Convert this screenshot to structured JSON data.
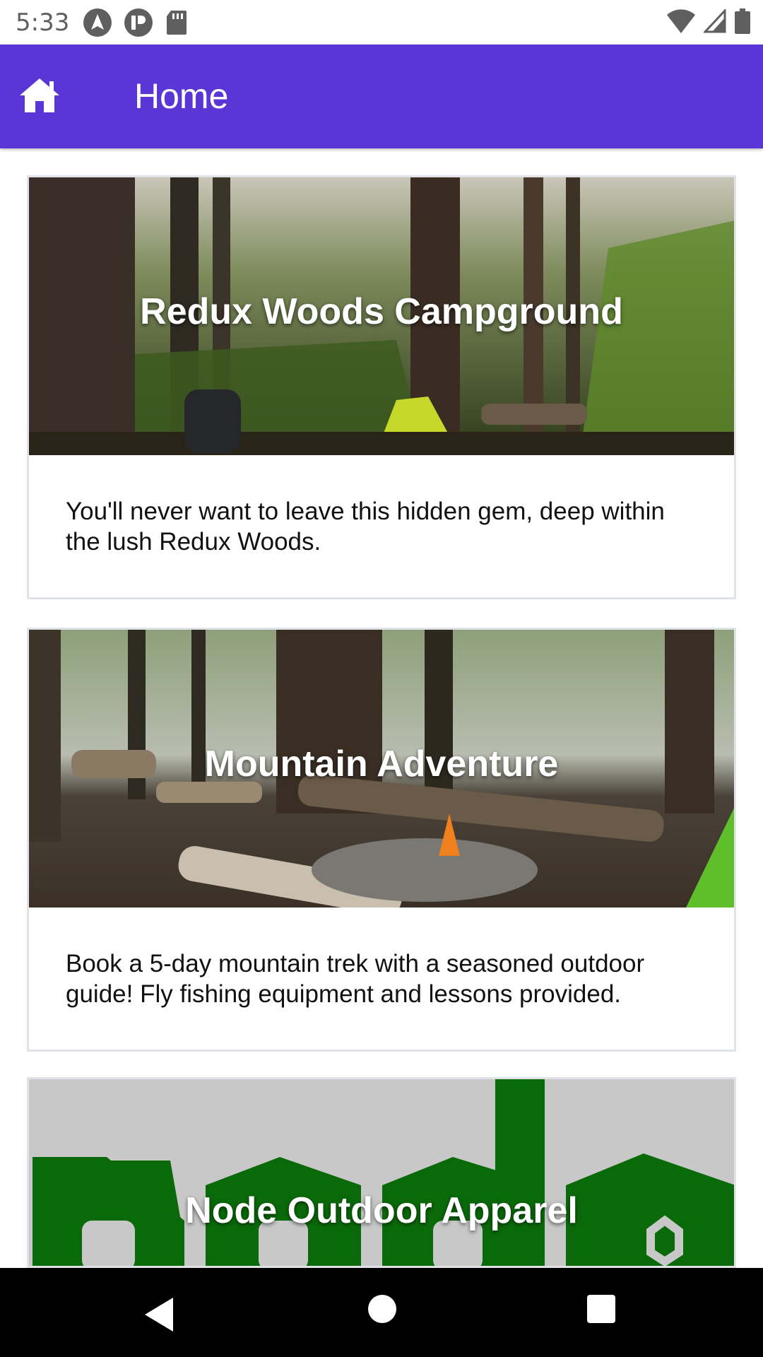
{
  "status_bar": {
    "time": "5:33",
    "left_icons": [
      "navigation-icon",
      "p-badge-icon",
      "sd-card-icon"
    ],
    "right_icons": [
      "wifi-icon",
      "signal-icon",
      "battery-icon"
    ]
  },
  "app_bar": {
    "title": "Home",
    "icon": "home-icon",
    "color": "#5a36d6"
  },
  "cards": [
    {
      "title": "Redux Woods Campground",
      "description": "You'll never want to leave this hidden gem, deep within the lush Redux Woods."
    },
    {
      "title": "Mountain Adventure",
      "description": "Book a 5-day mountain trek with a seasoned outdoor guide! Fly fishing equipment and lessons provided."
    },
    {
      "title": "Node Outdoor Apparel",
      "description": ""
    }
  ],
  "nav_bar": {
    "icons": [
      "back-icon",
      "home-circle-icon",
      "recents-icon"
    ]
  }
}
